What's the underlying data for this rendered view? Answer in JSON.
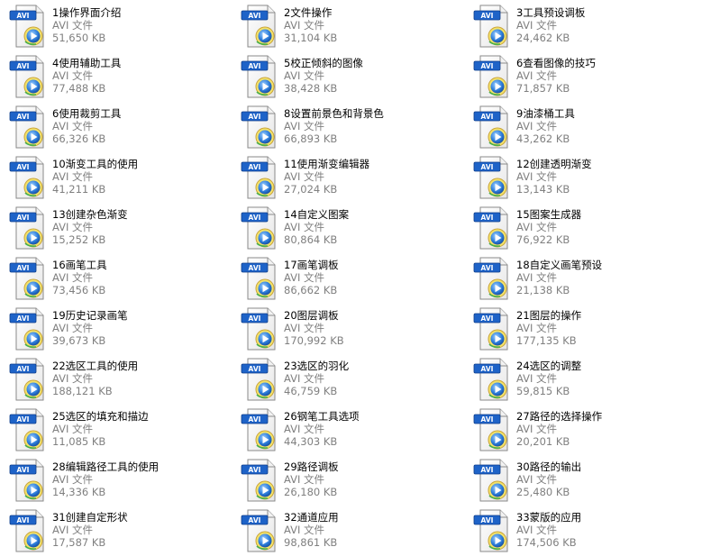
{
  "colors": {
    "name_text": "#000000",
    "meta_text": "#808080",
    "avi_badge": "#1e63c8",
    "play_button": "#2f7fdc"
  },
  "file_icon": "avi-video-file-icon",
  "files": [
    {
      "name": "1操作界面介绍",
      "type": "AVI 文件",
      "size": "51,650 KB"
    },
    {
      "name": "2文件操作",
      "type": "AVI 文件",
      "size": "31,104 KB"
    },
    {
      "name": "3工具预设调板",
      "type": "AVI 文件",
      "size": "24,462 KB"
    },
    {
      "name": "4使用辅助工具",
      "type": "AVI 文件",
      "size": "77,488 KB"
    },
    {
      "name": "5校正倾斜的图像",
      "type": "AVI 文件",
      "size": "38,428 KB"
    },
    {
      "name": "6查看图像的技巧",
      "type": "AVI 文件",
      "size": "71,857 KB"
    },
    {
      "name": "6使用裁剪工具",
      "type": "AVI 文件",
      "size": "66,326 KB"
    },
    {
      "name": "8设置前景色和背景色",
      "type": "AVI 文件",
      "size": "66,893 KB"
    },
    {
      "name": "9油漆桶工具",
      "type": "AVI 文件",
      "size": "43,262 KB"
    },
    {
      "name": "10渐变工具的使用",
      "type": "AVI 文件",
      "size": "41,211 KB"
    },
    {
      "name": "11使用渐变编辑器",
      "type": "AVI 文件",
      "size": "27,024 KB"
    },
    {
      "name": "12创建透明渐变",
      "type": "AVI 文件",
      "size": "13,143 KB"
    },
    {
      "name": "13创建杂色渐变",
      "type": "AVI 文件",
      "size": "15,252 KB"
    },
    {
      "name": "14自定义图案",
      "type": "AVI 文件",
      "size": "80,864 KB"
    },
    {
      "name": "15图案生成器",
      "type": "AVI 文件",
      "size": "76,922 KB"
    },
    {
      "name": "16画笔工具",
      "type": "AVI 文件",
      "size": "73,456 KB"
    },
    {
      "name": "17画笔调板",
      "type": "AVI 文件",
      "size": "86,662 KB"
    },
    {
      "name": "18自定义画笔预设",
      "type": "AVI 文件",
      "size": "21,138 KB"
    },
    {
      "name": "19历史记录画笔",
      "type": "AVI 文件",
      "size": "39,673 KB"
    },
    {
      "name": "20图层调板",
      "type": "AVI 文件",
      "size": "170,992 KB"
    },
    {
      "name": "21图层的操作",
      "type": "AVI 文件",
      "size": "177,135 KB"
    },
    {
      "name": "22选区工具的使用",
      "type": "AVI 文件",
      "size": "188,121 KB"
    },
    {
      "name": "23选区的羽化",
      "type": "AVI 文件",
      "size": "46,759 KB"
    },
    {
      "name": "24选区的调整",
      "type": "AVI 文件",
      "size": "59,815 KB"
    },
    {
      "name": "25选区的填充和描边",
      "type": "AVI 文件",
      "size": "11,085 KB"
    },
    {
      "name": "26钢笔工具选项",
      "type": "AVI 文件",
      "size": "44,303 KB"
    },
    {
      "name": "27路径的选择操作",
      "type": "AVI 文件",
      "size": "20,201 KB"
    },
    {
      "name": "28编辑路径工具的使用",
      "type": "AVI 文件",
      "size": "14,336 KB"
    },
    {
      "name": "29路径调板",
      "type": "AVI 文件",
      "size": "26,180 KB"
    },
    {
      "name": "30路径的输出",
      "type": "AVI 文件",
      "size": "25,480 KB"
    },
    {
      "name": "31创建自定形状",
      "type": "AVI 文件",
      "size": "17,587 KB"
    },
    {
      "name": "32通道应用",
      "type": "AVI 文件",
      "size": "98,861 KB"
    },
    {
      "name": "33蒙版的应用",
      "type": "AVI 文件",
      "size": "174,506 KB"
    }
  ]
}
